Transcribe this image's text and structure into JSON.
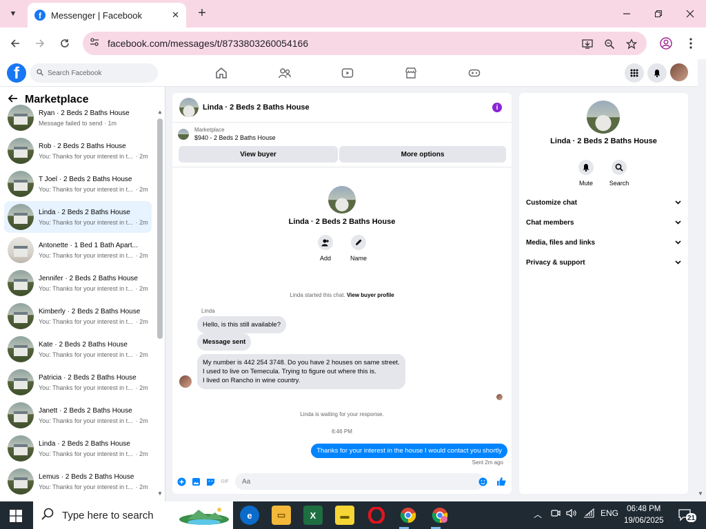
{
  "browser": {
    "tab_title": "Messenger | Facebook",
    "url": "facebook.com/messages/t/8733803260054166"
  },
  "fb": {
    "search_placeholder": "Search Facebook"
  },
  "left": {
    "title": "Marketplace",
    "conversations": [
      {
        "name": "Ryan · 2 Beds 2 Baths House",
        "preview": "Message failed to send · 1m",
        "time": "",
        "selected": false
      },
      {
        "name": "Rob · 2 Beds 2 Baths House",
        "preview": "You: Thanks for your interest in t...",
        "time": "· 2m",
        "selected": false
      },
      {
        "name": "T Joel · 2 Beds 2 Baths House",
        "preview": "You: Thanks for your interest in t...",
        "time": "· 2m",
        "selected": false
      },
      {
        "name": "Linda · 2 Beds 2 Baths House",
        "preview": "You: Thanks for your interest in t...",
        "time": "· 2m",
        "selected": true
      },
      {
        "name": "Antonette · 1 Bed 1 Bath Apart...",
        "preview": "You: Thanks for your interest in t...",
        "time": "· 2m",
        "selected": false
      },
      {
        "name": "Jennifer · 2 Beds 2 Baths House",
        "preview": "You: Thanks for your interest in t...",
        "time": "· 2m",
        "selected": false
      },
      {
        "name": "Kimberly · 2 Beds 2 Baths House",
        "preview": "You: Thanks for your interest in t...",
        "time": "· 2m",
        "selected": false
      },
      {
        "name": "Kate · 2 Beds 2 Baths House",
        "preview": "You: Thanks for your interest in t...",
        "time": "· 2m",
        "selected": false
      },
      {
        "name": "Patricia · 2 Beds 2 Baths House",
        "preview": "You: Thanks for your interest in t...",
        "time": "· 2m",
        "selected": false
      },
      {
        "name": "Janett · 2 Beds 2 Baths House",
        "preview": "You: Thanks for your interest in t...",
        "time": "· 2m",
        "selected": false
      },
      {
        "name": "Linda · 2 Beds 2 Baths House",
        "preview": "You: Thanks for your interest in t...",
        "time": "· 2m",
        "selected": false
      },
      {
        "name": "Lemus · 2 Beds 2 Baths House",
        "preview": "You: Thanks for your interest in t...",
        "time": "· 2m",
        "selected": false
      }
    ]
  },
  "chat": {
    "title": "Linda · 2 Beds 2 Baths House",
    "marketplace_label": "Marketplace",
    "listing": "$940 - 2 Beds 2 Baths House",
    "view_buyer": "View buyer",
    "more_options": "More options",
    "contact_name": "Linda · 2 Beds 2 Baths House",
    "add_label": "Add",
    "name_label": "Name",
    "started_text": "Linda started this chat.",
    "view_buyer_profile": "View buyer profile",
    "sender": "Linda",
    "msg1": "Hello, is this still available?",
    "msg2": "Message sent",
    "msg3_line1": "My number is 442 254 3748. Do you have 2 houses on same street.",
    "msg3_line2": "I used to live on Temecula. Trying to figure out where this is.",
    "msg3_line3": "I lived on Rancho in wine country.",
    "waiting": "Linda is waiting for your response.",
    "time": "6:46 PM",
    "my_msg": "Thanks for your interest in the house I would contact you shortly",
    "sent_status": "Sent 2m ago",
    "composer_placeholder": "Aa"
  },
  "right": {
    "name": "Linda · 2 Beds 2 Baths House",
    "mute": "Mute",
    "search": "Search",
    "sections": [
      "Customize chat",
      "Chat members",
      "Media, files and links",
      "Privacy & support"
    ]
  },
  "taskbar": {
    "search_placeholder": "Type here to search",
    "lang": "ENG",
    "time": "06:48 PM",
    "date": "19/06/2025",
    "notifications": "21"
  },
  "colors": {
    "fb_blue": "#1877f2",
    "messenger_blue": "#0084ff",
    "tab_pink": "#f9d8e6",
    "info_purple": "#8b25d6"
  }
}
